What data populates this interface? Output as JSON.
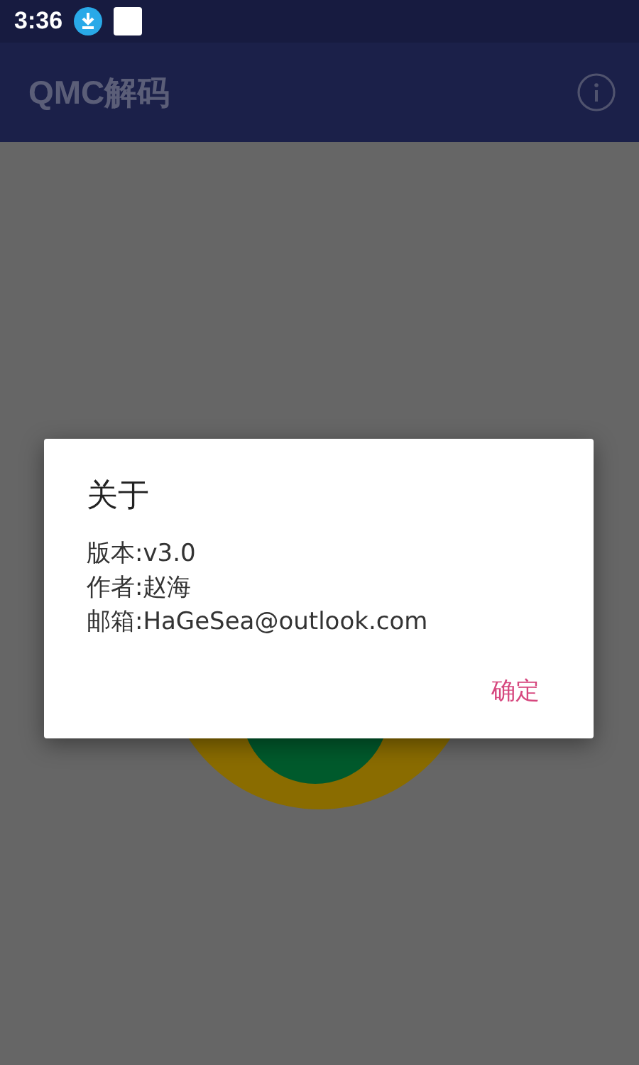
{
  "status_bar": {
    "time": "3:36"
  },
  "app_bar": {
    "title": "QMC解码"
  },
  "dialog": {
    "title": "关于",
    "lines": [
      "版本:v3.0",
      "作者:赵海",
      "邮箱:HaGeSea@outlook.com"
    ],
    "button": "确定"
  }
}
